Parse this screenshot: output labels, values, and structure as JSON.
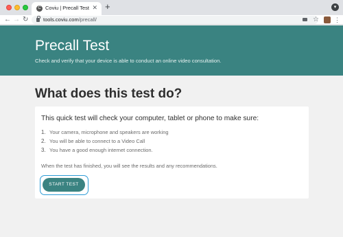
{
  "browser": {
    "tab_title": "Coviu | Precall Test",
    "tab_favicon": "C",
    "tab_close": "✕",
    "new_tab": "+",
    "url_host": "tools.coviu.com",
    "url_path": "/precall/",
    "nav_back": "←",
    "nav_forward": "→",
    "nav_reload": "↻",
    "star": "☆",
    "menu": "⋮",
    "window_control": "▾"
  },
  "hero": {
    "title": "Precall Test",
    "subtitle": "Check and verify that your device is able to conduct an online video consultation."
  },
  "main": {
    "section_title": "What does this test do?",
    "intro": "This quick test will check your computer, tablet or phone to make sure:",
    "checks": [
      {
        "num": "1.",
        "text": "Your camera, microphone and speakers are working"
      },
      {
        "num": "2.",
        "text": "You will be able to connect to a Video Call"
      },
      {
        "num": "3.",
        "text": "You have a good enough internet connection."
      }
    ],
    "note": "When the test has finished, you will see the results and any recommendations.",
    "start_button": "START TEST"
  },
  "colors": {
    "brand_teal": "#3a8381",
    "focus_ring": "#2b9bd6",
    "page_bg": "#f1f1f1"
  },
  "icons": [
    "lock-icon",
    "camera-icon",
    "star-icon",
    "kebab-menu-icon",
    "reload-icon",
    "back-arrow-icon",
    "forward-arrow-icon"
  ]
}
